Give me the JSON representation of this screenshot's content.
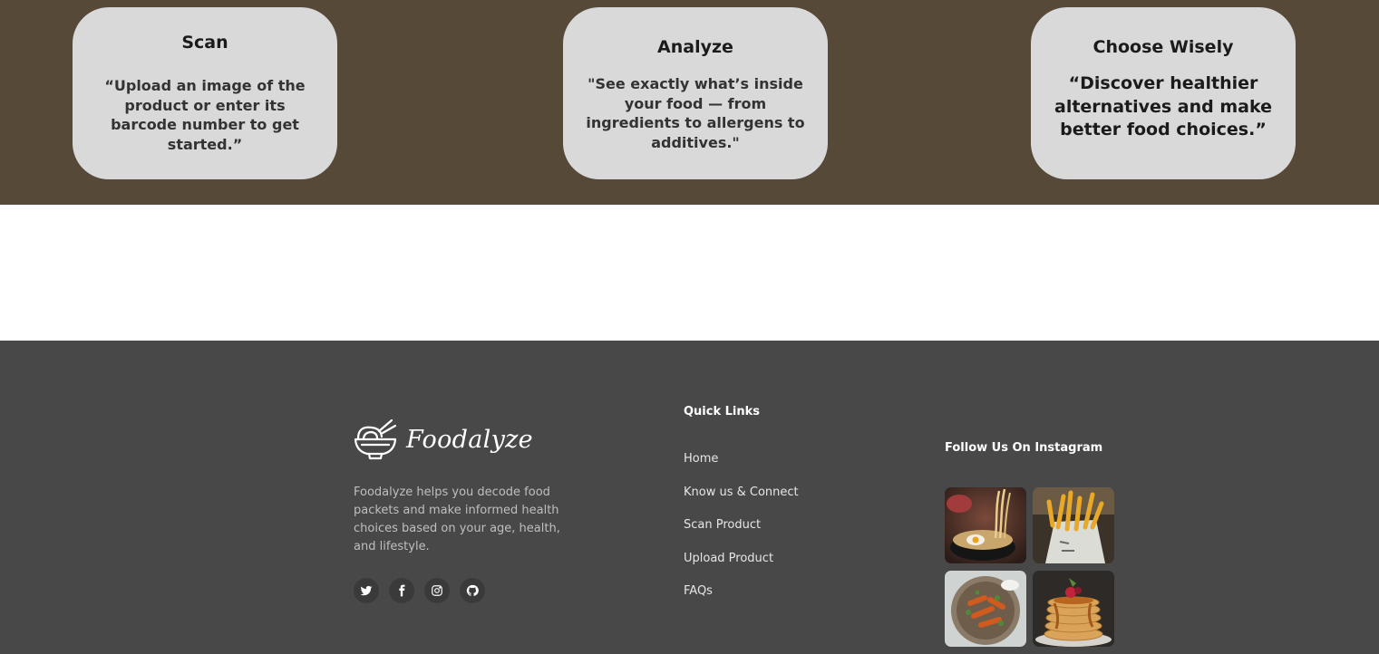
{
  "steps": [
    {
      "title": "Scan",
      "text": "“Upload an image of the product or enter its barcode number to get started.”"
    },
    {
      "title": "Analyze",
      "text": "\"See exactly what’s inside your food — from ingredients to allergens to additives.\""
    },
    {
      "title": "Choose Wisely",
      "text": "“Discover healthier alternatives and make better food choices.”"
    }
  ],
  "footer": {
    "brand": {
      "name": "Foodalyze",
      "logo_icon": "noodle-bowl-icon",
      "description": "Foodalyze helps you decode food packets and make informed health choices based on your age, health, and lifestyle."
    },
    "socials": [
      {
        "name": "twitter-icon"
      },
      {
        "name": "facebook-icon"
      },
      {
        "name": "instagram-icon"
      },
      {
        "name": "github-icon"
      }
    ],
    "quick_links": {
      "title": "Quick Links",
      "items": [
        "Home",
        "Know us & Connect",
        "Scan Product",
        "Upload Product",
        "FAQs"
      ]
    },
    "instagram": {
      "title": "Follow Us On Instagram",
      "images": [
        "noodle-egg-bowl",
        "french-fries",
        "sweet-potato-plate",
        "pancake-stack"
      ]
    }
  },
  "colors": {
    "steps_band_bg": "#564938",
    "card_bg": "#d9d9d9",
    "footer_bg": "#484848",
    "social_bg": "#3a3a3a"
  }
}
